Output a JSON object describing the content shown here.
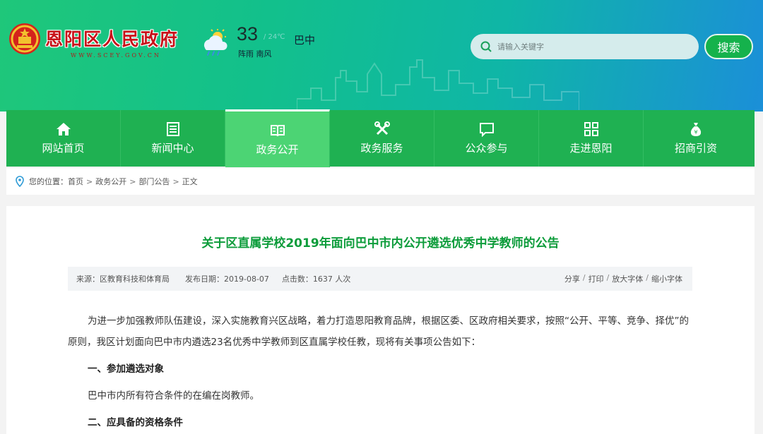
{
  "header": {
    "site_title": "恩阳区人民政府",
    "site_url": "WWW.SCEY.GOV.CN",
    "weather": {
      "temperature": "33",
      "range": "/ 24℃",
      "city": "巴中",
      "description": "阵雨 南风",
      "icon": "rain-cloud-icon"
    },
    "search": {
      "placeholder": "请输入关键字",
      "button": "搜索"
    }
  },
  "nav": {
    "items": [
      {
        "label": "网站首页",
        "icon": "home-icon"
      },
      {
        "label": "新闻中心",
        "icon": "news-icon"
      },
      {
        "label": "政务公开",
        "icon": "book-icon",
        "active": true
      },
      {
        "label": "政务服务",
        "icon": "tools-icon"
      },
      {
        "label": "公众参与",
        "icon": "chat-icon"
      },
      {
        "label": "走进恩阳",
        "icon": "grid-icon"
      },
      {
        "label": "招商引资",
        "icon": "money-bag-icon"
      }
    ]
  },
  "breadcrumb": {
    "prefix": "您的位置：",
    "items": [
      "首页",
      "政务公开",
      "部门公告",
      "正文"
    ],
    "separator": ">"
  },
  "article": {
    "title": "关于区直属学校2019年面向巴中市内公开遴选优秀中学教师的公告",
    "meta": {
      "source": "来源：区教育科技和体育局",
      "date": "发布日期：2019-08-07",
      "clicks": "点击数：1637 人次"
    },
    "tools": [
      "分享",
      "打印",
      "放大字体",
      "缩小字体"
    ],
    "paragraphs": {
      "intro": "为进一步加强教师队伍建设，深入实施教育兴区战略，着力打造恩阳教育品牌，根据区委、区政府相关要求，按照“公开、平等、竞争、择优”的原则，我区计划面向巴中市内遴选23名优秀中学教师到区直属学校任教，现将有关事项公告如下：",
      "heading1": "一、参加遴选对象",
      "text1": "巴中市内所有符合条件的在编在岗教师。",
      "heading2": "二、应具备的资格条件"
    }
  },
  "colors": {
    "nav_green": "#1fb152",
    "nav_active": "#4cd474",
    "title_green": "#0d9c3b",
    "site_title_red": "#c8121a"
  }
}
